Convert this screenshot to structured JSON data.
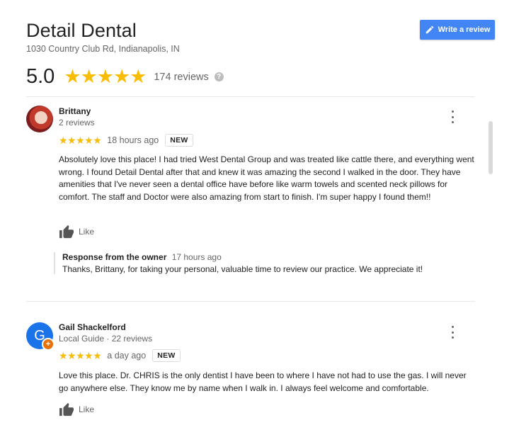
{
  "business": {
    "name": "Detail Dental",
    "address": "1030 Country Club Rd, Indianapolis, IN",
    "rating": "5.0",
    "stars": "★★★★★",
    "review_count": "174 reviews",
    "help_glyph": "?"
  },
  "write_review_label": "Write a review",
  "reviews": [
    {
      "name": "Brittany",
      "meta": "2 reviews",
      "stars": "★★★★★",
      "time": "18 hours ago",
      "badge": "NEW",
      "text": "Absolutely love this place! I had tried West Dental Group and was treated like cattle there, and everything went wrong. I found Detail Dental after that and knew it was amazing the second I walked in the door. They have amenities that I've never seen a dental office have before like warm towels and scented neck pillows for comfort. The staff and Doctor were also amazing from start to finish. I'm super happy I found them!!",
      "like_label": "Like",
      "owner_response": {
        "title": "Response from the owner",
        "time": "17 hours ago",
        "text": "Thanks, Brittany, for taking your personal, valuable time to review our practice. We appreciate it!"
      }
    },
    {
      "name": "Gail Shackelford",
      "avatar_letter": "G",
      "guide_badge": "+",
      "meta": "Local Guide · 22 reviews",
      "stars": "★★★★★",
      "time": "a day ago",
      "badge": "NEW",
      "text": "Love this place. Dr. CHRIS is the only dentist I have been to where I have not had to use the gas. I will never go anywhere else. They know me by name when I walk in. I always feel welcome and comfortable.",
      "like_label": "Like"
    }
  ],
  "colors": {
    "star": "#fbbc04",
    "button": "#4285f4",
    "avatar_g": "#1a73e8",
    "local_guide": "#e8710a"
  }
}
